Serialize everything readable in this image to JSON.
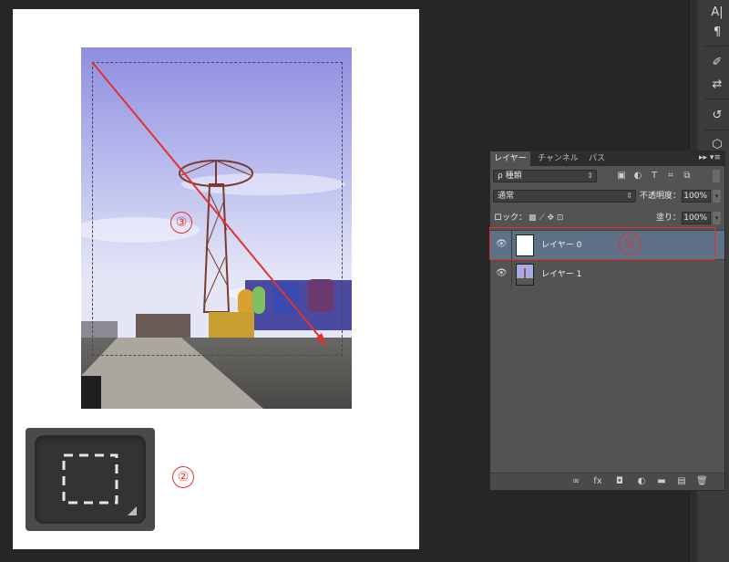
{
  "canvas": {
    "selection_tool_icon": "rectangular-marquee-icon",
    "markers": [
      "③",
      "②",
      "①"
    ]
  },
  "right_strip": {
    "icons": [
      "character-icon",
      "paragraph-icon",
      "brush-icon",
      "adjust-icon",
      "history-icon",
      "3d-icon"
    ],
    "glyphs": [
      "A|",
      "¶",
      "✐",
      "⇄",
      "↺",
      "⬡"
    ]
  },
  "layers_panel": {
    "tabs": [
      "レイヤー",
      "チャンネル",
      "パス"
    ],
    "menu_glyph": "▸▸ ▾≡",
    "filter_select": "ρ 種類",
    "blend_mode": "通常",
    "opacity_label": "不透明度：",
    "opacity_value": "100%",
    "lock_label": "ロック：",
    "lock_icons": "▩ ⟋ ✥ ⊡",
    "fill_label": "塗り：",
    "fill_value": "100%",
    "layers": [
      {
        "name": "レイヤー 0",
        "visible": true,
        "selected": true
      },
      {
        "name": "レイヤー 1",
        "visible": true,
        "selected": false
      }
    ],
    "footer_icons": [
      "link-icon",
      "fx-icon",
      "mask-icon",
      "adjustment-icon",
      "group-icon",
      "new-layer-icon",
      "trash-icon"
    ],
    "footer_glyphs": [
      "∞",
      "fx",
      "◘",
      "◐",
      "▬",
      "▤",
      "🗑"
    ]
  },
  "colors": {
    "annotation_red": "#e53030",
    "selected_layer": "#5e7186",
    "panel_bg": "#535353"
  }
}
